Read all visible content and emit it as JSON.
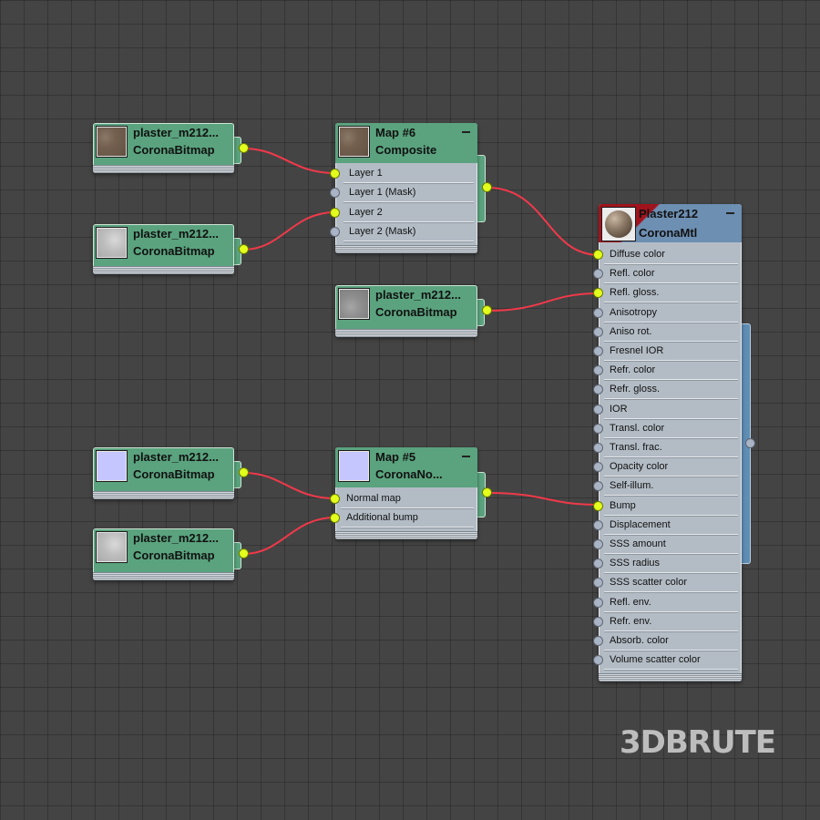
{
  "nodes": {
    "bitmap_1": {
      "title": "plaster_m212...",
      "type": "CoronaBitmap",
      "thumbnail": "brown-plaster-texture"
    },
    "bitmap_2": {
      "title": "plaster_m212...",
      "type": "CoronaBitmap",
      "thumbnail": "light-gray-plaster-texture"
    },
    "bitmap_3": {
      "title": "plaster_m212...",
      "type": "CoronaBitmap",
      "thumbnail": "gray-plaster-texture"
    },
    "bitmap_4": {
      "title": "plaster_m212...",
      "type": "CoronaBitmap",
      "thumbnail": "normal-map-texture"
    },
    "bitmap_5": {
      "title": "plaster_m212...",
      "type": "CoronaBitmap",
      "thumbnail": "light-gray-plaster-texture"
    },
    "composite": {
      "title": "Map #6",
      "type": "Composite",
      "slots": [
        "Layer 1",
        "Layer 1 (Mask)",
        "Layer 2",
        "Layer 2 (Mask)"
      ]
    },
    "normal": {
      "title": "Map #5",
      "type": "CoronaNo...",
      "slots": [
        "Normal map",
        "Additional bump"
      ]
    },
    "material": {
      "title": "Plaster212",
      "type": "CoronaMtl",
      "slots": [
        "Diffuse color",
        "Refl. color",
        "Refl. gloss.",
        "Anisotropy",
        "Aniso rot.",
        "Fresnel IOR",
        "Refr. color",
        "Refr. gloss.",
        "IOR",
        "Transl. color",
        "Transl. frac.",
        "Opacity color",
        "Self-illum.",
        "Bump",
        "Displacement",
        "SSS amount",
        "SSS radius",
        "SSS scatter color",
        "Refl. env.",
        "Refr. env.",
        "Absorb. color",
        "Volume scatter color"
      ]
    }
  },
  "connections": [
    {
      "from": "bitmap_1",
      "to": "composite",
      "slot": "Layer 1"
    },
    {
      "from": "bitmap_2",
      "to": "composite",
      "slot": "Layer 2"
    },
    {
      "from": "composite",
      "to": "material",
      "slot": "Diffuse color"
    },
    {
      "from": "bitmap_3",
      "to": "material",
      "slot": "Refl. gloss."
    },
    {
      "from": "bitmap_4",
      "to": "normal",
      "slot": "Normal map"
    },
    {
      "from": "bitmap_5",
      "to": "normal",
      "slot": "Additional bump"
    },
    {
      "from": "normal",
      "to": "material",
      "slot": "Bump"
    }
  ],
  "colors": {
    "background": "#444444",
    "map_node": "#5aa37e",
    "slot_panel": "#b3bcc5",
    "wire": "#f0394a",
    "socket_connected": "#e3ff1d",
    "socket_empty": "#a9b4c5",
    "material_header_red": "#a0131c",
    "material_header_blue": "#6d8fb2"
  },
  "watermark": "3DBRUTE"
}
